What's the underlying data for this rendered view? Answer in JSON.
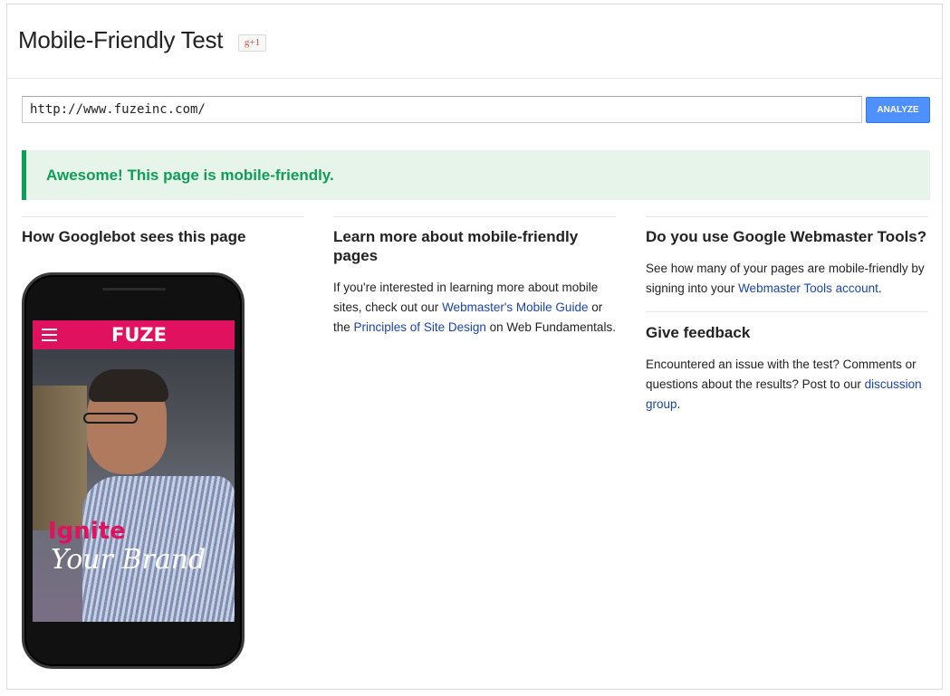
{
  "header": {
    "title": "Mobile-Friendly Test",
    "gplus_label": "g+1"
  },
  "search": {
    "url_value": "http://www.fuzeinc.com/",
    "analyze_label": "ANALYZE"
  },
  "result": {
    "message": "Awesome! This page is mobile-friendly."
  },
  "col1": {
    "heading": "How Googlebot sees this page"
  },
  "phone": {
    "logo": "FUZE",
    "headline1": "Ignite",
    "headline2": "Your Brand"
  },
  "col2": {
    "heading": "Learn more about mobile-friendly pages",
    "text1": "If you're interested in learning more about mobile sites, check out our ",
    "link1": "Webmaster's Mobile Guide",
    "text2": " or the ",
    "link2": "Principles of Site Design",
    "text3": " on Web Fundamentals."
  },
  "col3": {
    "heading": "Do you use Google Webmaster Tools?",
    "text1": "See how many of your pages are mobile-friendly by signing into your ",
    "link1": "Webmaster Tools account",
    "text2": ".",
    "feedback_heading": "Give feedback",
    "feedback_text": "Encountered an issue with the test? Comments or questions about the results? Post to our ",
    "feedback_link": "discussion group",
    "feedback_end": "."
  },
  "colors": {
    "success_green": "#0f9d58",
    "success_bg": "#e6f4ea",
    "button_blue": "#4d90fe",
    "fuze_pink": "#e0115f",
    "link_blue": "#1a44b0"
  }
}
